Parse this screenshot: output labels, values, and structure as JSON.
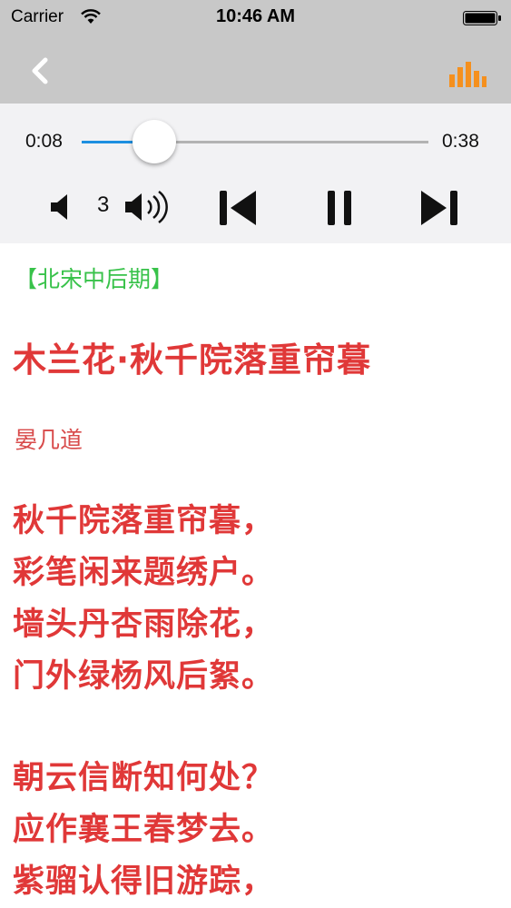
{
  "status_bar": {
    "carrier": "Carrier",
    "time": "10:46 AM"
  },
  "nav": {
    "back_icon": "chevron-left-icon",
    "right_icon": "equalizer-bars-icon",
    "accent_color": "#f5901e"
  },
  "player": {
    "current_time": "0:08",
    "total_time": "0:38",
    "progress": 0.21,
    "volume": "3",
    "progress_color": "#1d8fe0"
  },
  "poem": {
    "era": "【北宋中后期】",
    "title": "木兰花·秋千院落重帘暮",
    "author": "晏几道",
    "stanza1": [
      "秋千院落重帘暮，",
      "彩笔闲来题绣户。",
      "墙头丹杏雨除花，",
      "门外绿杨风后絮。"
    ],
    "stanza2": [
      "朝云信断知何处？",
      "应作襄王春梦去。",
      "紫骝认得旧游踪，"
    ],
    "era_color": "#38c24a",
    "text_color": "#e03838"
  }
}
